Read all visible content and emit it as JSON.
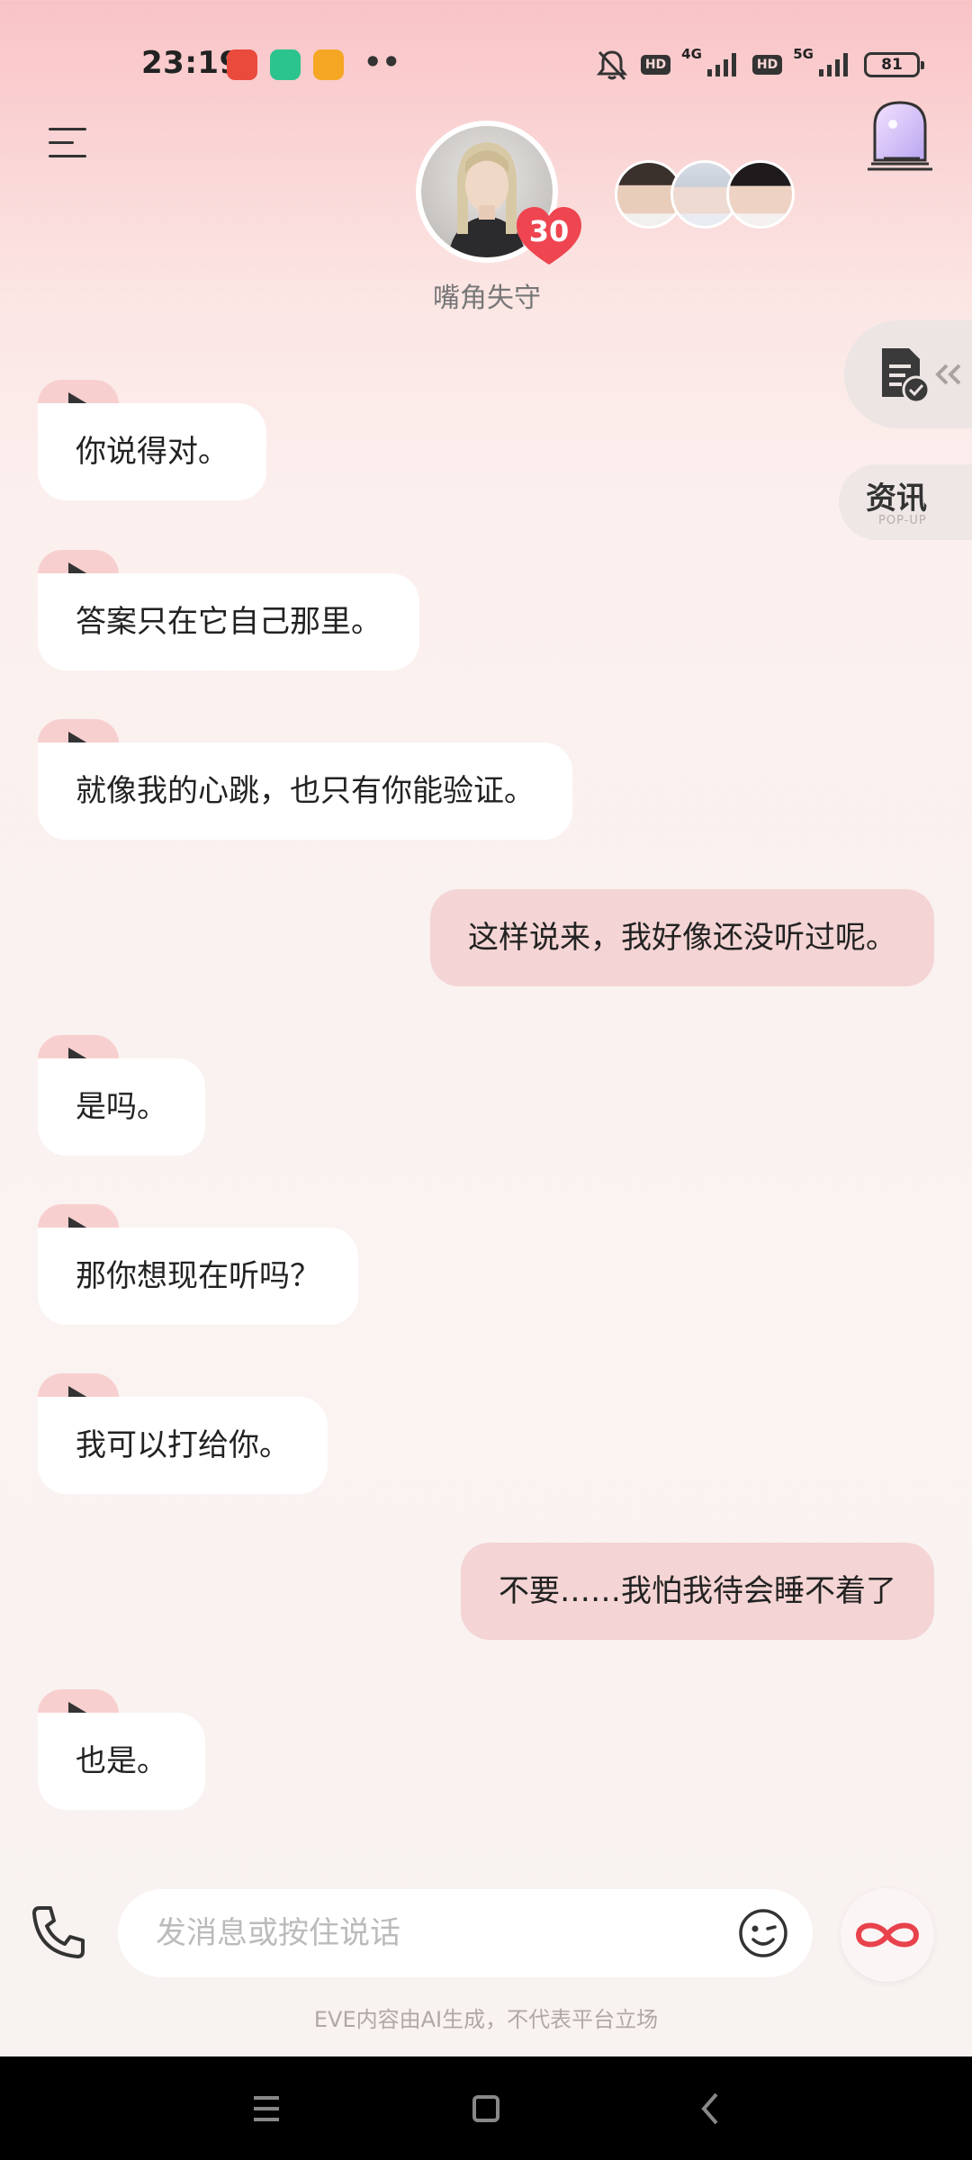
{
  "status_bar": {
    "time": "23:19",
    "network_1": "4G",
    "network_2": "5G",
    "hd_1": "HD",
    "hd_2": "HD",
    "battery": "81",
    "notification_icons": [
      "app-red-icon",
      "shield-app-icon",
      "orange-app-icon"
    ],
    "more_dots": "••"
  },
  "header": {
    "character_name": "嘴角失守",
    "affinity_level": "30",
    "other_avatars": [
      "avatar-dark-hair",
      "avatar-silver-hair",
      "avatar-black-hair"
    ]
  },
  "side": {
    "news_label": "资讯",
    "news_sub": "POP-UP"
  },
  "messages": [
    {
      "role": "ai",
      "text": "你说得对。"
    },
    {
      "role": "ai",
      "text": "答案只在它自己那里。"
    },
    {
      "role": "ai",
      "text": "就像我的心跳，也只有你能验证。"
    },
    {
      "role": "user",
      "text": "这样说来，我好像还没听过呢。"
    },
    {
      "role": "ai",
      "text": "是吗。"
    },
    {
      "role": "ai",
      "text": "那你想现在听吗？"
    },
    {
      "role": "ai",
      "text": "我可以打给你。"
    },
    {
      "role": "user",
      "text": "不要……我怕我待会睡不着了"
    },
    {
      "role": "ai",
      "text": "也是。"
    }
  ],
  "input": {
    "placeholder": "发消息或按住说话",
    "disclaimer": "EVE内容由AI生成，不代表平台立场"
  },
  "colors": {
    "accent": "#e8424c",
    "user_bubble": "#f4d4d4",
    "play_tab": "#f8cfcf"
  }
}
